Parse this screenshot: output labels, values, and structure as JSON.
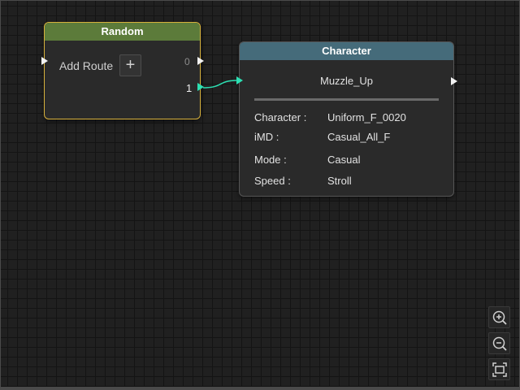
{
  "random_node": {
    "title": "Random",
    "add_route_label": "Add Route",
    "add_button": "+",
    "ports": [
      "0",
      "1"
    ],
    "header_color": "#5c7b3a",
    "border_color": "#d7b13d"
  },
  "character_node": {
    "title": "Character",
    "subtitle": "Muzzle_Up",
    "header_color": "#456b7a",
    "properties": [
      {
        "key": "Character :",
        "value": "Uniform_F_0020"
      },
      {
        "key": "iMD :",
        "value": "Casual_All_F"
      },
      {
        "key": "Mode :",
        "value": "Casual"
      },
      {
        "key": "Speed :",
        "value": "Stroll"
      }
    ]
  },
  "connection_color": "#2de0b3",
  "zoom_controls": {
    "icons": [
      "zoom-in-icon",
      "zoom-out-icon",
      "fit-view-icon"
    ]
  }
}
